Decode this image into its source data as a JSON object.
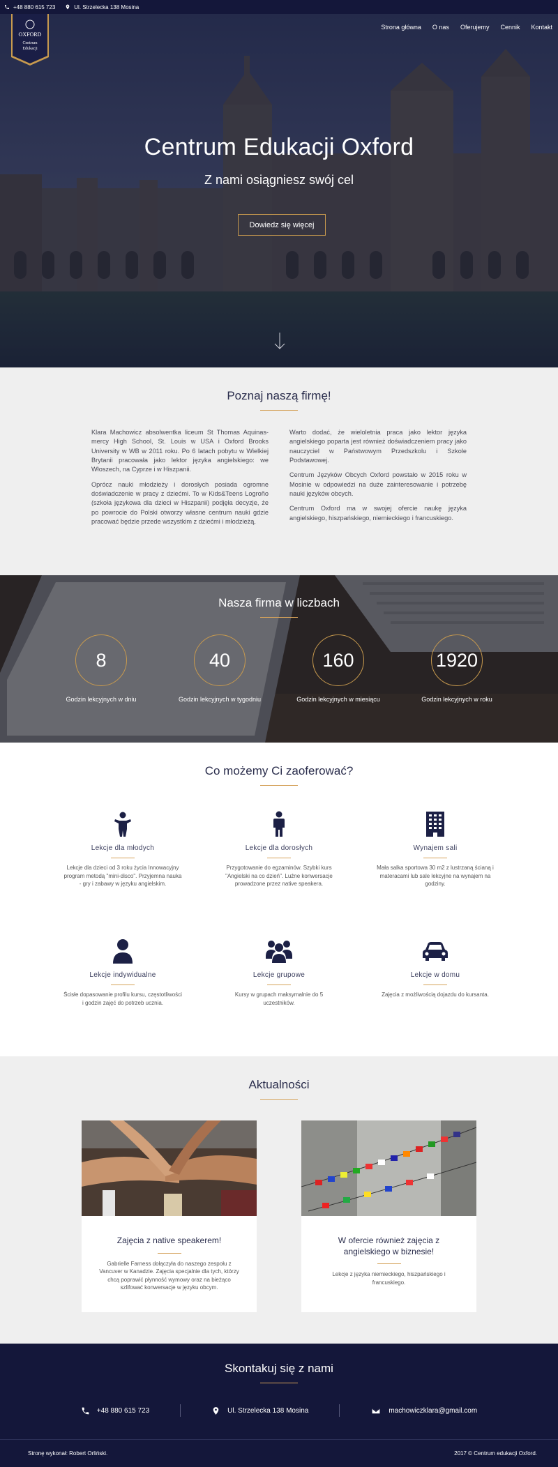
{
  "topbar": {
    "phone": "+48 880 615 723",
    "address": "Ul. Strzelecka 138 Mosina"
  },
  "logo": {
    "line1": "OXFORD",
    "line2": "Centrum",
    "line3": "Edukacji"
  },
  "nav": [
    "Strona główna",
    "O nas",
    "Oferujemy",
    "Cennik",
    "Kontakt"
  ],
  "hero": {
    "title": "Centrum Edukacji Oxford",
    "subtitle": "Z nami osiągniesz swój cel",
    "button": "Dowiedz się więcej"
  },
  "about": {
    "title": "Poznaj naszą firmę!",
    "left": [
      "Klara Machowicz absolwentka liceum St Thomas Aquinas-mercy High School, St. Louis w USA i Oxford Brooks University w WB w 2011 roku. Po 6 latach pobytu w Wielkiej Brytanii pracowała jako lektor języka angielskiego: we Włoszech, na Cyprze i w Hiszpanii.",
      "Oprócz nauki młodzieży i dorosłych posiada ogromne doświadczenie w pracy z dziećmi. To w Kids&Teens Logroño (szkoła językowa dla dzieci w Hiszpanii) podjęła decyzje, że po powrocie do Polski otworzy własne centrum nauki gdzie pracować będzie przede wszystkim z dziećmi i młodzieżą."
    ],
    "right": [
      "Warto dodać, że wieloletnia praca jako lektor języka angielskiego poparta jest również doświadczeniem pracy jako nauczyciel w Państwowym Przedszkolu i Szkole Podstawowej.",
      "Centrum Języków Obcych Oxford powstało w 2015 roku w Mosinie w odpowiedzi na duże zainteresowanie i potrzebę nauki języków obcych.",
      "Centrum Oxford ma w swojej ofercie naukę języka angielskiego, hiszpańskiego, niemieckiego i francuskiego."
    ]
  },
  "numbers": {
    "title": "Nasza firma w liczbach",
    "stats": [
      {
        "value": "8",
        "label": "Godzin lekcyjnych w dniu"
      },
      {
        "value": "40",
        "label": "Godzin lekcyjnych w tygodniu"
      },
      {
        "value": "160",
        "label": "Godzin lekcyjnych w miesiącu"
      },
      {
        "value": "1920",
        "label": "Godzin lekcyjnych w roku"
      }
    ]
  },
  "offer": {
    "title": "Co możemy Ci zaoferować?",
    "items": [
      {
        "icon": "child-icon",
        "title": "Lekcje dla młodych",
        "text": "Lekcje dla dzieci od 3 roku życia Innowacyjny program metodą \"mini-disco\". Przyjemna nauka - gry i zabawy w języku angielskim."
      },
      {
        "icon": "adult-icon",
        "title": "Lekcje dla dorosłych",
        "text": "Przygotowanie do egzaminów. Szybki kurs \"Angielski na co dzień\". Luźne konwersacje prowadzone przez native speakera."
      },
      {
        "icon": "building-icon",
        "title": "Wynajem sali",
        "text": "Mała salka sportowa 30 m2 z lustrzaną ścianą i materacami lub sale lekcyjne na wynajem na godziny."
      },
      {
        "icon": "user-icon",
        "title": "Lekcje indywidualne",
        "text": "Ścisłe dopasowanie profilu kursu, częstotliwości i godzin zajęć do potrzeb ucznia."
      },
      {
        "icon": "group-icon",
        "title": "Lekcje grupowe",
        "text": "Kursy w grupach maksymalnie do 5 uczestników."
      },
      {
        "icon": "car-icon",
        "title": "Lekcje w domu",
        "text": "Zajęcia z możliwością dojazdu do kursanta."
      }
    ]
  },
  "news": {
    "title": "Aktualności",
    "cards": [
      {
        "title": "Zajęcia z native speakerem!",
        "text": "Gabrielle Farness dołączyła do naszego zespołu z Vancuver w Kanadzie. Zajęcia specjalnie dla tych, którzy chcą poprawić płynność wymowy oraz na bieżąco szlifować konwersacje w języku obcym."
      },
      {
        "title": "W ofercie również zajęcia z angielskiego w biznesie!",
        "text": "Lekcje z języka niemieckiego, hiszpańskiego i francuskiego."
      }
    ]
  },
  "contact": {
    "title": "Skontakuj się z nami",
    "phone": "+48 880 615 723",
    "address": "Ul. Strzelecka 138 Mosina",
    "email": "machowiczklara@gmail.com"
  },
  "footer": {
    "left": "Stronę wykonał: Robert Orliński.",
    "right": "2017 © Centrum edukacji Oxford."
  },
  "colors": {
    "navy": "#14173a",
    "gold": "#d5a25a",
    "light": "#efefef"
  }
}
